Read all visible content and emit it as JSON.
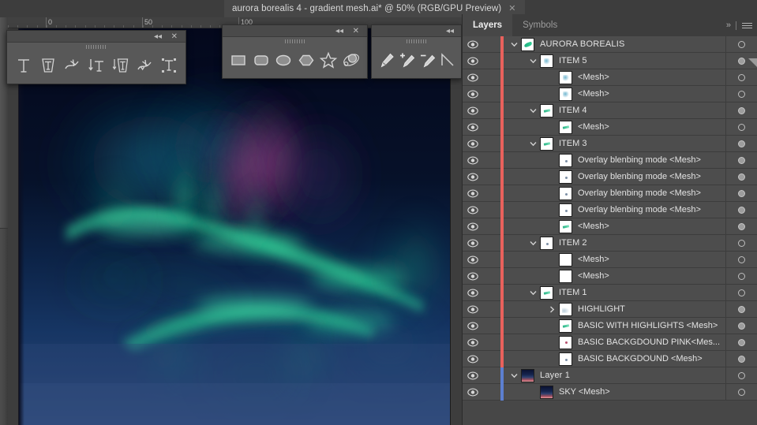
{
  "window": {
    "document_tab_title": "aurora borealis 4 - gradient mesh.ai* @ 50% (RGB/GPU Preview)",
    "tab_close_glyph": "✕"
  },
  "ruler": {
    "labels": [
      "0",
      "50",
      "100"
    ],
    "label_positions": [
      48,
      170,
      292
    ]
  },
  "palettes": [
    {
      "id": "type-tools",
      "collapse_glyph": "◂◂",
      "close_glyph": "✕",
      "items": [
        {
          "name": "type-tool-icon",
          "label": "Type Tool"
        },
        {
          "name": "area-type-tool-icon",
          "label": "Area Type Tool"
        },
        {
          "name": "type-on-path-tool-icon",
          "label": "Type on a Path Tool"
        },
        {
          "name": "vertical-type-tool-icon",
          "label": "Vertical Type Tool"
        },
        {
          "name": "vertical-area-type-tool-icon",
          "label": "Vertical Area Type Tool"
        },
        {
          "name": "vertical-type-on-path-tool-icon",
          "label": "Vertical Type on a Path Tool"
        },
        {
          "name": "touch-type-tool-icon",
          "label": "Touch Type Tool"
        }
      ]
    },
    {
      "id": "shape-tools",
      "collapse_glyph": "◂◂",
      "close_glyph": "✕",
      "items": [
        {
          "name": "rectangle-tool-icon",
          "label": "Rectangle Tool"
        },
        {
          "name": "rounded-rectangle-tool-icon",
          "label": "Rounded Rectangle Tool"
        },
        {
          "name": "ellipse-tool-icon",
          "label": "Ellipse Tool"
        },
        {
          "name": "polygon-tool-icon",
          "label": "Polygon Tool"
        },
        {
          "name": "star-tool-icon",
          "label": "Star Tool"
        },
        {
          "name": "flare-tool-icon",
          "label": "Flare Tool"
        }
      ]
    },
    {
      "id": "pen-tools",
      "collapse_glyph": "◂◂",
      "close_glyph": "",
      "items": [
        {
          "name": "pen-tool-icon",
          "label": "Pen Tool"
        },
        {
          "name": "add-anchor-point-tool-icon",
          "label": "Add Anchor Point Tool"
        },
        {
          "name": "delete-anchor-point-tool-icon",
          "label": "Delete Anchor Point Tool"
        },
        {
          "name": "anchor-point-tool-icon",
          "label": "Anchor Point Tool"
        }
      ]
    }
  ],
  "panel": {
    "tabs": [
      {
        "label": "Layers",
        "active": true
      },
      {
        "label": "Symbols",
        "active": false
      }
    ],
    "chevrons_glyph": "»"
  },
  "colors": {
    "layer_bar_red": "#e8615c",
    "layer_bar_blue": "#5c7fd0",
    "panel_bg": "#474747",
    "row_bg": "#4d4d4d",
    "accent_green": "#2fd39a",
    "accent_magenta": "#8a3a7a",
    "sky_dark": "#04081c",
    "sky_light": "#2b4270"
  },
  "layers": [
    {
      "name": "AURORA BOREALIS",
      "indent": 0,
      "arrow": "down",
      "thumb": "aurora",
      "bar": "red",
      "target_filled": false,
      "expanded": true
    },
    {
      "name": "ITEM 5",
      "indent": 1,
      "arrow": "down",
      "thumb": "faint",
      "bar": "red",
      "target_filled": true,
      "expanded": true
    },
    {
      "name": "<Mesh>",
      "indent": 2,
      "arrow": "none",
      "thumb": "faint",
      "bar": "red",
      "target_filled": false,
      "expanded": false
    },
    {
      "name": "<Mesh>",
      "indent": 2,
      "arrow": "none",
      "thumb": "faint",
      "bar": "red",
      "target_filled": false,
      "expanded": false
    },
    {
      "name": "ITEM 4",
      "indent": 1,
      "arrow": "down",
      "thumb": "greenstroke",
      "bar": "red",
      "target_filled": true,
      "expanded": true
    },
    {
      "name": "<Mesh>",
      "indent": 2,
      "arrow": "none",
      "thumb": "greenstroke",
      "bar": "red",
      "target_filled": false,
      "expanded": false
    },
    {
      "name": "ITEM 3",
      "indent": 1,
      "arrow": "down",
      "thumb": "greenstroke",
      "bar": "red",
      "target_filled": true,
      "expanded": true
    },
    {
      "name": "Overlay blenbing mode <Mesh>",
      "indent": 2,
      "arrow": "none",
      "thumb": "dot",
      "bar": "red",
      "target_filled": true,
      "expanded": false
    },
    {
      "name": "Overlay blenbing mode <Mesh>",
      "indent": 2,
      "arrow": "none",
      "thumb": "dot",
      "bar": "red",
      "target_filled": true,
      "expanded": false
    },
    {
      "name": "Overlay blenbing mode <Mesh>",
      "indent": 2,
      "arrow": "none",
      "thumb": "dot",
      "bar": "red",
      "target_filled": true,
      "expanded": false
    },
    {
      "name": "Overlay blenbing mode <Mesh>",
      "indent": 2,
      "arrow": "none",
      "thumb": "dot",
      "bar": "red",
      "target_filled": true,
      "expanded": false
    },
    {
      "name": "<Mesh>",
      "indent": 2,
      "arrow": "none",
      "thumb": "greenstroke",
      "bar": "red",
      "target_filled": true,
      "expanded": false
    },
    {
      "name": "ITEM 2",
      "indent": 1,
      "arrow": "down",
      "thumb": "dot",
      "bar": "red",
      "target_filled": false,
      "expanded": true
    },
    {
      "name": "<Mesh>",
      "indent": 2,
      "arrow": "none",
      "thumb": "white",
      "bar": "red",
      "target_filled": false,
      "expanded": false
    },
    {
      "name": "<Mesh>",
      "indent": 2,
      "arrow": "none",
      "thumb": "white",
      "bar": "red",
      "target_filled": false,
      "expanded": false
    },
    {
      "name": "ITEM 1",
      "indent": 1,
      "arrow": "down",
      "thumb": "greenstroke",
      "bar": "red",
      "target_filled": false,
      "expanded": true
    },
    {
      "name": "HIGHLIGHT",
      "indent": 2,
      "arrow": "right",
      "thumb": "highlight",
      "bar": "red",
      "target_filled": true,
      "expanded": false
    },
    {
      "name": "BASIC WITH HIGHLIGHTS <Mesh>",
      "indent": 2,
      "arrow": "none",
      "thumb": "greenstroke",
      "bar": "red",
      "target_filled": true,
      "expanded": false
    },
    {
      "name": "BASIC BACKGDOUND PINK<Mes...",
      "indent": 2,
      "arrow": "none",
      "thumb": "pink",
      "bar": "red",
      "target_filled": true,
      "expanded": false
    },
    {
      "name": "BASIC BACKGDOUND <Mesh>",
      "indent": 2,
      "arrow": "none",
      "thumb": "dot",
      "bar": "red",
      "target_filled": true,
      "expanded": false
    },
    {
      "name": "Layer 1",
      "indent": 0,
      "arrow": "down",
      "thumb": "sky",
      "bar": "blue",
      "target_filled": false,
      "expanded": true
    },
    {
      "name": "SKY <Mesh>",
      "indent": 1,
      "arrow": "none",
      "thumb": "sky",
      "bar": "blue",
      "target_filled": false,
      "expanded": false
    }
  ]
}
